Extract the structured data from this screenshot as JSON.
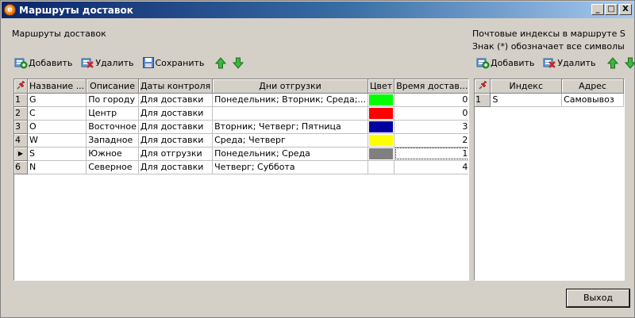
{
  "window": {
    "title": "Маршруты доставок",
    "app_icon_letter": "e",
    "buttons": {
      "minimize": "_",
      "maximize": "□",
      "close": "X"
    }
  },
  "left": {
    "section_label": "Маршруты доставок",
    "toolbar": {
      "add_label": "Добавить",
      "delete_label": "Удалить",
      "save_label": "Сохранить"
    },
    "table": {
      "columns": [
        "Название ...",
        "Описание",
        "Даты контроля",
        "Дни отгрузки",
        "Цвет",
        "Время достав..."
      ],
      "rows": [
        {
          "num": "1",
          "name": "G",
          "desc": "По городу",
          "control": "Для доставки",
          "days": "Понедельник; Вторник; Среда;...",
          "color": "#00ff00",
          "time": "0"
        },
        {
          "num": "2",
          "name": "C",
          "desc": "Центр",
          "control": "Для доставки",
          "days": "",
          "color": "#ff0000",
          "time": "0"
        },
        {
          "num": "3",
          "name": "O",
          "desc": "Восточное",
          "control": "Для доставки",
          "days": "Вторник; Четверг; Пятница",
          "color": "#0000a0",
          "time": "3"
        },
        {
          "num": "4",
          "name": "W",
          "desc": "Западное",
          "control": "Для доставки",
          "days": "Среда; Четверг",
          "color": "#ffff00",
          "time": "2"
        },
        {
          "num": "▶",
          "name": "S",
          "desc": "Южное",
          "control": "Для отгрузки",
          "days": "Понедельник; Среда",
          "color": "#808080",
          "time": "1"
        },
        {
          "num": "6",
          "name": "N",
          "desc": "Северное",
          "control": "Для доставки",
          "days": "Четверг; Суббота",
          "color": "",
          "time": "4"
        }
      ]
    }
  },
  "right": {
    "postal_label": "Почтовые индексы в маршруте  S",
    "hint_label": "Знак (*) обозначает все символы",
    "toolbar": {
      "add_label": "Добавить",
      "delete_label": "Удалить"
    },
    "table": {
      "columns": [
        "Индекс",
        "Адрес"
      ],
      "rows": [
        {
          "num": "1",
          "index": "S",
          "address": "Самовывоз"
        }
      ]
    }
  },
  "footer": {
    "exit_label": "Выход"
  },
  "icons": {
    "add": "add-icon",
    "delete": "delete-icon",
    "save": "save-icon",
    "up": "arrow-up-icon",
    "down": "arrow-down-icon",
    "pin": "pin-icon"
  }
}
